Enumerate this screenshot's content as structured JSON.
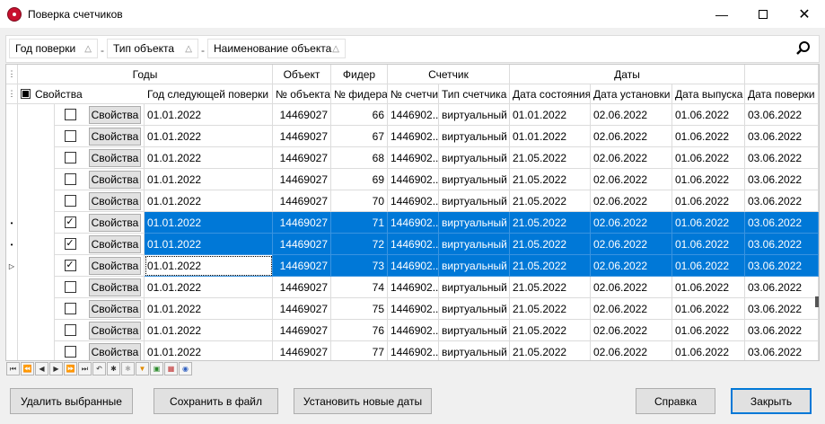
{
  "window": {
    "title": "Поверка счетчиков"
  },
  "groupbar": {
    "chips": [
      "Год поверки",
      "Тип объекта",
      "Наименование объекта"
    ],
    "separator": "-"
  },
  "header": {
    "bands": [
      "Годы",
      "Объект",
      "Фидер",
      "Счетчик",
      "Даты"
    ],
    "columns": [
      "Свойства",
      "Год следующей поверки",
      "№ объекта",
      "№ фидера",
      "№ счетчика",
      "Тип счетчика",
      "Дата состояния",
      "Дата установки",
      "Дата выпуска",
      "Дата поверки"
    ]
  },
  "button_label": "Свойства",
  "rows": [
    {
      "checked": false,
      "next": "01.01.2022",
      "obj": "14469027",
      "feeder": "66",
      "meter": "1446902...",
      "type": "виртуальный",
      "state": "01.01.2022",
      "install": "02.06.2022",
      "release": "01.06.2022",
      "verify": "03.06.2022",
      "selected": false,
      "marker": ""
    },
    {
      "checked": false,
      "next": "01.01.2022",
      "obj": "14469027",
      "feeder": "67",
      "meter": "1446902...",
      "type": "виртуальный",
      "state": "01.01.2022",
      "install": "02.06.2022",
      "release": "01.06.2022",
      "verify": "03.06.2022",
      "selected": false,
      "marker": ""
    },
    {
      "checked": false,
      "next": "01.01.2022",
      "obj": "14469027",
      "feeder": "68",
      "meter": "1446902...",
      "type": "виртуальный",
      "state": "21.05.2022",
      "install": "02.06.2022",
      "release": "01.06.2022",
      "verify": "03.06.2022",
      "selected": false,
      "marker": ""
    },
    {
      "checked": false,
      "next": "01.01.2022",
      "obj": "14469027",
      "feeder": "69",
      "meter": "1446902...",
      "type": "виртуальный",
      "state": "21.05.2022",
      "install": "02.06.2022",
      "release": "01.06.2022",
      "verify": "03.06.2022",
      "selected": false,
      "marker": ""
    },
    {
      "checked": false,
      "next": "01.01.2022",
      "obj": "14469027",
      "feeder": "70",
      "meter": "1446902...",
      "type": "виртуальный",
      "state": "21.05.2022",
      "install": "02.06.2022",
      "release": "01.06.2022",
      "verify": "03.06.2022",
      "selected": false,
      "marker": ""
    },
    {
      "checked": true,
      "next": "01.01.2022",
      "obj": "14469027",
      "feeder": "71",
      "meter": "1446902...",
      "type": "виртуальный",
      "state": "21.05.2022",
      "install": "02.06.2022",
      "release": "01.06.2022",
      "verify": "03.06.2022",
      "selected": true,
      "marker": "•"
    },
    {
      "checked": true,
      "next": "01.01.2022",
      "obj": "14469027",
      "feeder": "72",
      "meter": "1446902...",
      "type": "виртуальный",
      "state": "21.05.2022",
      "install": "02.06.2022",
      "release": "01.06.2022",
      "verify": "03.06.2022",
      "selected": true,
      "marker": "•"
    },
    {
      "checked": true,
      "next": "01.01.2022",
      "obj": "14469027",
      "feeder": "73",
      "meter": "1446902...",
      "type": "виртуальный",
      "state": "21.05.2022",
      "install": "02.06.2022",
      "release": "01.06.2022",
      "verify": "03.06.2022",
      "selected": true,
      "marker": "▷",
      "focus": true
    },
    {
      "checked": false,
      "next": "01.01.2022",
      "obj": "14469027",
      "feeder": "74",
      "meter": "1446902...",
      "type": "виртуальный",
      "state": "21.05.2022",
      "install": "02.06.2022",
      "release": "01.06.2022",
      "verify": "03.06.2022",
      "selected": false,
      "marker": ""
    },
    {
      "checked": false,
      "next": "01.01.2022",
      "obj": "14469027",
      "feeder": "75",
      "meter": "1446902...",
      "type": "виртуальный",
      "state": "21.05.2022",
      "install": "02.06.2022",
      "release": "01.06.2022",
      "verify": "03.06.2022",
      "selected": false,
      "marker": ""
    },
    {
      "checked": false,
      "next": "01.01.2022",
      "obj": "14469027",
      "feeder": "76",
      "meter": "1446902...",
      "type": "виртуальный",
      "state": "21.05.2022",
      "install": "02.06.2022",
      "release": "01.06.2022",
      "verify": "03.06.2022",
      "selected": false,
      "marker": ""
    },
    {
      "checked": false,
      "next": "01.01.2022",
      "obj": "14469027",
      "feeder": "77",
      "meter": "1446902...",
      "type": "виртуальный",
      "state": "21.05.2022",
      "install": "02.06.2022",
      "release": "01.06.2022",
      "verify": "03.06.2022",
      "selected": false,
      "marker": ""
    }
  ],
  "navigator": [
    "first",
    "prev-page",
    "prev",
    "next",
    "next-page",
    "last",
    "undo",
    "append",
    "delete",
    "filter",
    "export",
    "grid",
    "view"
  ],
  "buttons": {
    "delete": "Удалить выбранные",
    "save": "Сохранить в файл",
    "set_dates": "Установить новые даты",
    "help": "Справка",
    "close": "Закрыть"
  },
  "colors": {
    "selection": "#0078d7",
    "accent": "#0078d7"
  }
}
